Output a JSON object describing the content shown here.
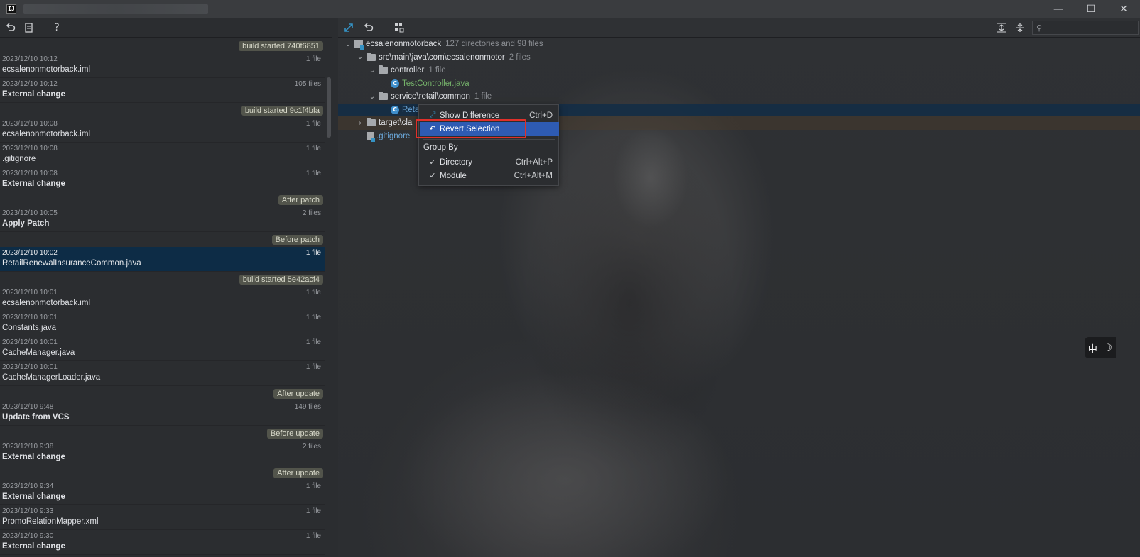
{
  "window": {
    "logo": "IJ",
    "controls": {
      "minimize": "—",
      "maximize": "☐",
      "close": "✕"
    }
  },
  "left_toolbar": {
    "icons": [
      "revert-icon",
      "patch-icon",
      "help-icon"
    ],
    "help_label": "?"
  },
  "history": [
    {
      "type": "label",
      "text": "build started 740f6851"
    },
    {
      "type": "item",
      "date": "2023/12/10 10:12",
      "count": "1 file",
      "name": "ecsalenonmotorback.iml",
      "bold": false
    },
    {
      "type": "item",
      "date": "2023/12/10 10:12",
      "count": "105 files",
      "name": "External change",
      "bold": true
    },
    {
      "type": "label",
      "text": "build started 9c1f4bfa"
    },
    {
      "type": "item",
      "date": "2023/12/10 10:08",
      "count": "1 file",
      "name": "ecsalenonmotorback.iml",
      "bold": false
    },
    {
      "type": "item",
      "date": "2023/12/10 10:08",
      "count": "1 file",
      "name": ".gitignore",
      "bold": false
    },
    {
      "type": "item",
      "date": "2023/12/10 10:08",
      "count": "1 file",
      "name": "External change",
      "bold": true
    },
    {
      "type": "label",
      "text": "After patch"
    },
    {
      "type": "item",
      "date": "2023/12/10 10:05",
      "count": "2 files",
      "name": "Apply Patch",
      "bold": true
    },
    {
      "type": "label",
      "text": "Before patch"
    },
    {
      "type": "item",
      "date": "2023/12/10 10:02",
      "count": "1 file",
      "name": "RetailRenewalInsuranceCommon.java",
      "bold": false,
      "selected": true
    },
    {
      "type": "label",
      "text": "build started 5e42acf4"
    },
    {
      "type": "item",
      "date": "2023/12/10 10:01",
      "count": "1 file",
      "name": "ecsalenonmotorback.iml",
      "bold": false
    },
    {
      "type": "item",
      "date": "2023/12/10 10:01",
      "count": "1 file",
      "name": "Constants.java",
      "bold": false
    },
    {
      "type": "item",
      "date": "2023/12/10 10:01",
      "count": "1 file",
      "name": "CacheManager.java",
      "bold": false
    },
    {
      "type": "item",
      "date": "2023/12/10 10:01",
      "count": "1 file",
      "name": "CacheManagerLoader.java",
      "bold": false
    },
    {
      "type": "label",
      "text": "After update"
    },
    {
      "type": "item",
      "date": "2023/12/10 9:48",
      "count": "149 files",
      "name": "Update from VCS",
      "bold": true
    },
    {
      "type": "label",
      "text": "Before update"
    },
    {
      "type": "item",
      "date": "2023/12/10 9:38",
      "count": "2 files",
      "name": "External change",
      "bold": true
    },
    {
      "type": "label",
      "text": "After update"
    },
    {
      "type": "item",
      "date": "2023/12/10 9:34",
      "count": "1 file",
      "name": "External change",
      "bold": true
    },
    {
      "type": "item",
      "date": "2023/12/10 9:33",
      "count": "1 file",
      "name": "PromoRelationMapper.xml",
      "bold": false
    },
    {
      "type": "item",
      "date": "2023/12/10 9:30",
      "count": "1 file",
      "name": "External change",
      "bold": true
    }
  ],
  "right_toolbar": {
    "icons": [
      "show-diff-icon",
      "revert-icon",
      "group-by-icon"
    ],
    "expand_all_icon": "expand-all-icon",
    "collapse_all_icon": "collapse-all-icon",
    "search_placeholder": "",
    "search_glyph": "⚲"
  },
  "tree": [
    {
      "kind": "module",
      "label": "ecsalenonmotorback",
      "count": "127 directories and 98 files",
      "indent": 0,
      "chevron": "⌄"
    },
    {
      "kind": "folder",
      "label": "src\\main\\java\\com\\ecsalenonmotor",
      "count": "2 files",
      "indent": 1,
      "chevron": "⌄"
    },
    {
      "kind": "folder",
      "label": "controller",
      "count": "1 file",
      "indent": 2,
      "chevron": "⌄"
    },
    {
      "kind": "class",
      "label": "TestController.java",
      "count": "",
      "indent": 3,
      "chevron": "",
      "color": "green"
    },
    {
      "kind": "folder",
      "label": "service\\retail\\common",
      "count": "1 file",
      "indent": 2,
      "chevron": "⌄"
    },
    {
      "kind": "class",
      "label": "Reta",
      "count": "",
      "indent": 3,
      "chevron": "",
      "color": "blue",
      "selected": true
    },
    {
      "kind": "folder",
      "label": "target\\cla",
      "count": "",
      "indent": 1,
      "chevron": "›",
      "band": true
    },
    {
      "kind": "file",
      "label": ".gitignore",
      "count": "",
      "indent": 1,
      "chevron": "",
      "color": "blue"
    }
  ],
  "context_menu": {
    "show_difference": {
      "label": "Show Difference",
      "shortcut": "Ctrl+D"
    },
    "revert_selection": {
      "label": "Revert Selection",
      "shortcut": ""
    },
    "group_by_header": "Group By",
    "directory": {
      "label": "Directory",
      "shortcut": "Ctrl+Alt+P",
      "checked": true
    },
    "module": {
      "label": "Module",
      "shortcut": "Ctrl+Alt+M",
      "checked": true
    }
  },
  "ime": {
    "char": "中",
    "moon": "☽"
  },
  "colors": {
    "accent_blue": "#3592c4",
    "highlight": "#2e5bb3",
    "selection_row": "#0d2c46",
    "annotation_red": "#e0302a",
    "label_tag_bg": "#52544b"
  }
}
